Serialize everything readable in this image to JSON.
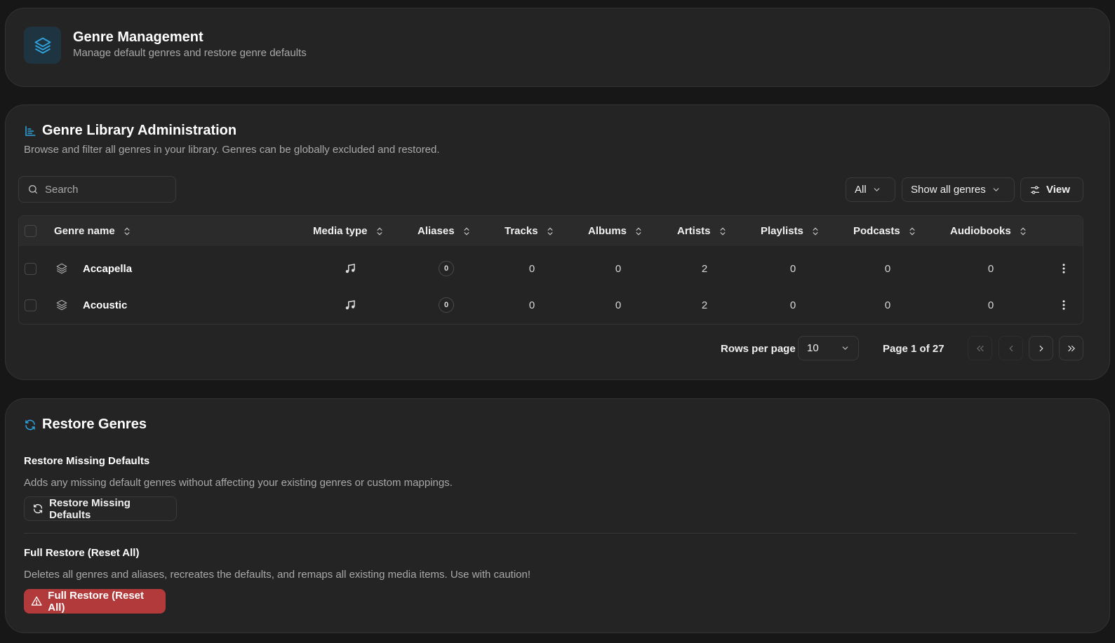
{
  "header": {
    "title": "Genre Management",
    "subtitle": "Manage default genres and restore genre defaults"
  },
  "library": {
    "title": "Genre Library Administration",
    "description": "Browse and filter all genres in your library. Genres can be globally excluded and restored.",
    "search_placeholder": "Search",
    "filter_all": "All",
    "filter_genres": "Show all genres",
    "view_label": "View",
    "columns": [
      "Genre name",
      "Media type",
      "Aliases",
      "Tracks",
      "Albums",
      "Artists",
      "Playlists",
      "Podcasts",
      "Audiobooks"
    ],
    "rows": [
      {
        "name": "Accapella",
        "media_type_icon": "music-note-icon",
        "aliases": "0",
        "tracks": "0",
        "albums": "0",
        "artists": "2",
        "playlists": "0",
        "podcasts": "0",
        "audiobooks": "0"
      },
      {
        "name": "Acoustic",
        "media_type_icon": "music-note-icon",
        "aliases": "0",
        "tracks": "0",
        "albums": "0",
        "artists": "2",
        "playlists": "0",
        "podcasts": "0",
        "audiobooks": "0"
      }
    ],
    "pagination": {
      "rows_per_page_label": "Rows per page",
      "rows_per_page_value": "10",
      "page_info": "Page 1 of 27"
    }
  },
  "restore": {
    "title": "Restore Genres",
    "missing_title": "Restore Missing Defaults",
    "missing_desc": "Adds any missing default genres without affecting your existing genres or custom mappings.",
    "missing_button": "Restore Missing Defaults",
    "full_title": "Full Restore (Reset All)",
    "full_desc": "Deletes all genres and aliases, recreates the defaults, and remaps all existing media items. Use with caution!",
    "full_button": "Full Restore (Reset All)"
  },
  "colors": {
    "accent": "#2fa3e0",
    "danger": "#b23a3a",
    "background": "#171717",
    "card": "#242424"
  }
}
